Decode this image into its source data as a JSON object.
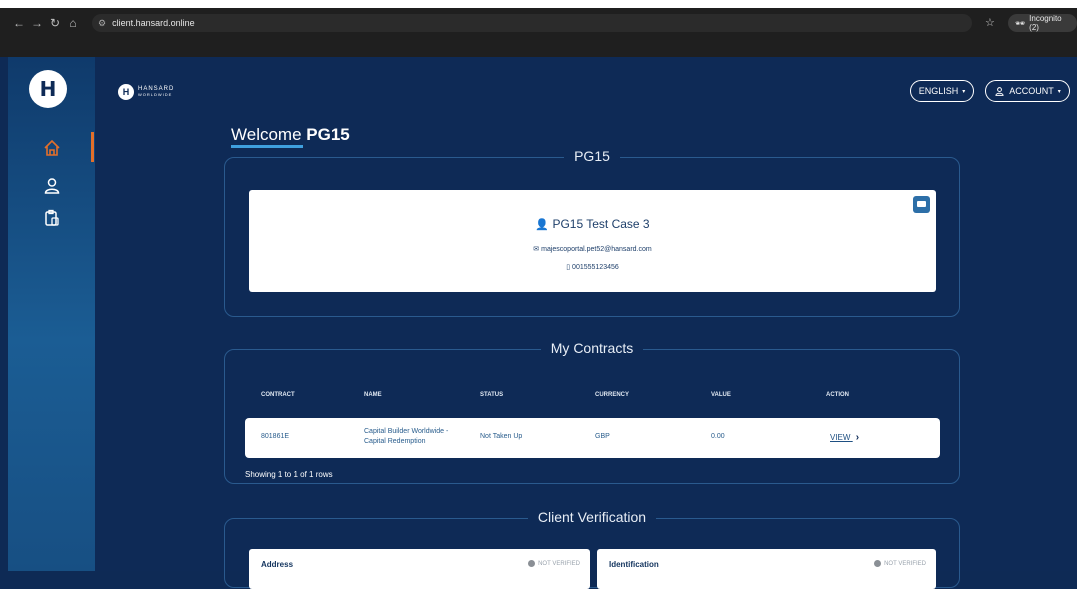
{
  "browser": {
    "url": "client.hansard.online",
    "incognito_label": "Incognito (2)"
  },
  "brand": {
    "logo_letter": "H",
    "name": "HANSARD",
    "tagline": "WORLDWIDE"
  },
  "header": {
    "language_label": "ENGLISH",
    "account_label": "ACCOUNT"
  },
  "welcome": {
    "prefix": "Welcome",
    "name": "PG15"
  },
  "profile": {
    "title": "PG15",
    "full_name": "PG15 Test Case 3",
    "email": "majescoportal.pet52@hansard.com",
    "phone": "001555123456"
  },
  "contracts": {
    "title": "My Contracts",
    "columns": [
      "CONTRACT",
      "NAME",
      "STATUS",
      "CURRENCY",
      "VALUE",
      "ACTION"
    ],
    "rows": [
      {
        "contract": "801861E",
        "name_line1": "Capital Builder Worldwide -",
        "name_line2": "Capital Redemption",
        "status": "Not Taken Up",
        "currency": "GBP",
        "value": "0.00",
        "action": "VIEW"
      }
    ],
    "showing": "Showing 1 to 1 of 1 rows"
  },
  "verification": {
    "title": "Client Verification",
    "address_label": "Address",
    "address_status": "NOT VERIFIED",
    "identification_label": "Identification",
    "identification_status": "NOT VERIFIED"
  },
  "colors": {
    "background": "#0e2a56",
    "accent": "#e36f2a",
    "underline": "#3fa0df"
  }
}
